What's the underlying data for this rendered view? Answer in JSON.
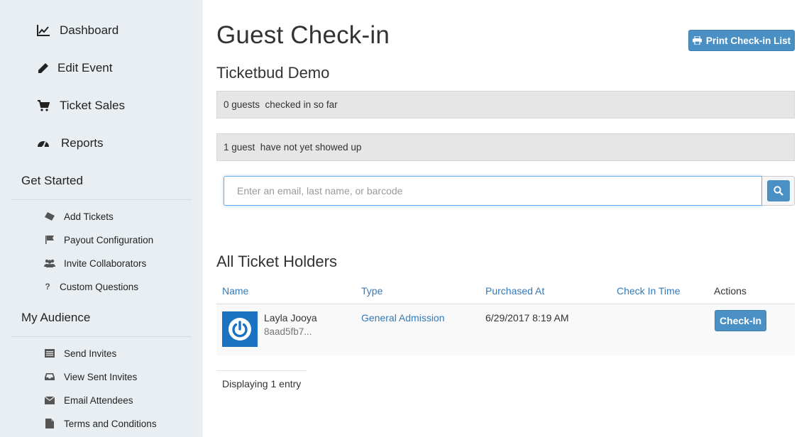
{
  "sidebar": {
    "main_items": [
      {
        "label": "Dashboard",
        "icon": "line-chart-icon"
      },
      {
        "label": "Edit Event",
        "icon": "pencil-icon"
      },
      {
        "label": "Ticket Sales",
        "icon": "cart-icon"
      },
      {
        "label": "Reports",
        "icon": "gauge-icon"
      }
    ],
    "get_started": {
      "title": "Get Started",
      "items": [
        {
          "label": "Add Tickets",
          "icon": "ticket-icon"
        },
        {
          "label": "Payout Configuration",
          "icon": "flag-icon"
        },
        {
          "label": "Invite Collaborators",
          "icon": "users-icon"
        },
        {
          "label": "Custom Questions",
          "icon": "question-icon"
        }
      ]
    },
    "my_audience": {
      "title": "My Audience",
      "items": [
        {
          "label": "Send Invites",
          "icon": "list-icon"
        },
        {
          "label": "View Sent Invites",
          "icon": "inbox-icon"
        },
        {
          "label": "Email Attendees",
          "icon": "envelope-icon"
        },
        {
          "label": "Terms and Conditions",
          "icon": "file-icon"
        }
      ]
    }
  },
  "main": {
    "title": "Guest Check-in",
    "print_button": "Print Check-in List",
    "event_name": "Ticketbud Demo",
    "checked_in_text": "0 guests  checked in so far",
    "not_showed_text": "1 guest  have not yet showed up",
    "search": {
      "placeholder": "Enter an email, last name, or barcode",
      "value": ""
    },
    "holders_title": "All Ticket Holders",
    "table": {
      "headers": [
        "Name",
        "Type",
        "Purchased At",
        "Check In Time",
        "Actions"
      ],
      "rows": [
        {
          "name": "Layla Jooya",
          "code": "8aad5fb7...",
          "type": "General Admission",
          "purchased_at": "6/29/2017 8:19 AM",
          "check_in_time": "",
          "action": "Check-In"
        }
      ]
    },
    "pager_text": "Displaying 1 entry"
  },
  "colors": {
    "accent": "#4a90c4",
    "link": "#337ab7",
    "sidebar_bg": "#e9eef2",
    "avatar_bg": "#1a73c1"
  }
}
